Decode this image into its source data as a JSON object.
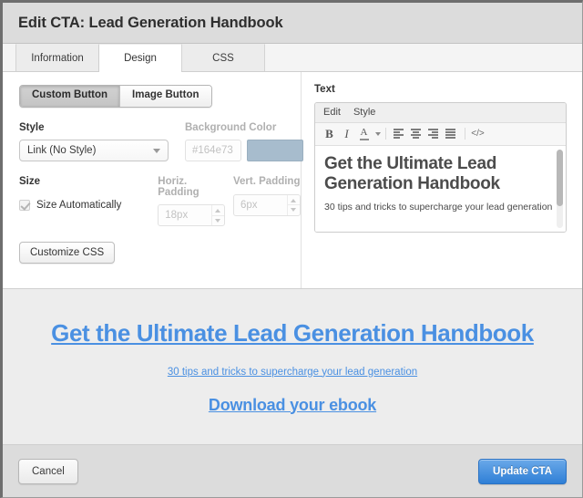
{
  "window": {
    "title": "Edit CTA: Lead Generation Handbook"
  },
  "tabs": [
    {
      "label": "Information",
      "active": false
    },
    {
      "label": "Design",
      "active": true
    },
    {
      "label": "CSS",
      "active": false
    }
  ],
  "design": {
    "button_type_toggle": {
      "custom_label": "Custom Button",
      "image_label": "Image Button",
      "selected": "Custom Button"
    },
    "style": {
      "label": "Style",
      "value": "Link (No Style)"
    },
    "background_color": {
      "label": "Background Color",
      "hex_value": "#164e73",
      "swatch_color": "#a7bccd",
      "disabled": true
    },
    "size": {
      "label": "Size",
      "auto_label": "Size Automatically",
      "auto_checked": true
    },
    "horiz_padding": {
      "label": "Horiz. Padding",
      "value": "18px"
    },
    "vert_padding": {
      "label": "Vert. Padding",
      "value": "6px"
    },
    "customize_css_label": "Customize CSS"
  },
  "text_editor": {
    "label": "Text",
    "menus": [
      "Edit",
      "Style"
    ],
    "toolbar": [
      {
        "name": "bold-icon",
        "glyph": "B"
      },
      {
        "name": "italic-icon",
        "glyph": "I"
      },
      {
        "name": "text-color-icon",
        "glyph": "A"
      },
      {
        "name": "align-left-icon",
        "glyph": ""
      },
      {
        "name": "align-center-icon",
        "glyph": ""
      },
      {
        "name": "align-right-icon",
        "glyph": ""
      },
      {
        "name": "align-justify-icon",
        "glyph": ""
      },
      {
        "name": "source-code-icon",
        "glyph": "</>"
      }
    ],
    "content": {
      "heading": "Get the Ultimate Lead Generation Handbook",
      "paragraph": "30 tips and tricks to supercharge your lead generation"
    }
  },
  "preview": {
    "heading": "Get the Ultimate Lead Generation Handbook",
    "subheading": "30 tips and tricks to supercharge your lead generation",
    "cta": "Download your ebook",
    "link_color": "#4a90e2"
  },
  "footer": {
    "cancel_label": "Cancel",
    "update_label": "Update CTA",
    "primary_color": "#2f7fd6"
  }
}
